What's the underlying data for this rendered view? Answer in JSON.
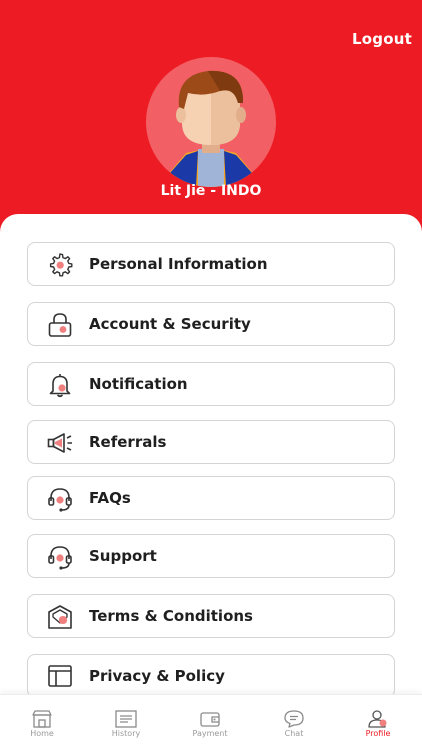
{
  "header": {
    "logout_label": "Logout",
    "username": "Lit Jie - INDO"
  },
  "colors": {
    "brand": "#ed1c24",
    "accent_soft": "#f25f65",
    "text": "#1f1f1f",
    "muted": "#9a9a9a"
  },
  "menu": {
    "items": [
      {
        "label": "Personal Information",
        "icon": "gear-icon"
      },
      {
        "label": "Account & Security",
        "icon": "lock-icon"
      },
      {
        "label": "Notification",
        "icon": "bell-icon"
      },
      {
        "label": "Referrals",
        "icon": "megaphone-icon"
      },
      {
        "label": "FAQs",
        "icon": "headset-icon"
      },
      {
        "label": "Support",
        "icon": "headset-icon"
      },
      {
        "label": "Terms & Conditions",
        "icon": "shield-icon"
      },
      {
        "label": "Privacy & Policy",
        "icon": "window-icon"
      }
    ]
  },
  "bottom_nav": {
    "items": [
      {
        "label": "Home",
        "icon": "home-icon"
      },
      {
        "label": "History",
        "icon": "history-icon"
      },
      {
        "label": "Payment",
        "icon": "wallet-icon"
      },
      {
        "label": "Chat",
        "icon": "chat-icon"
      },
      {
        "label": "Profile",
        "icon": "profile-icon"
      }
    ],
    "active": "Profile"
  }
}
